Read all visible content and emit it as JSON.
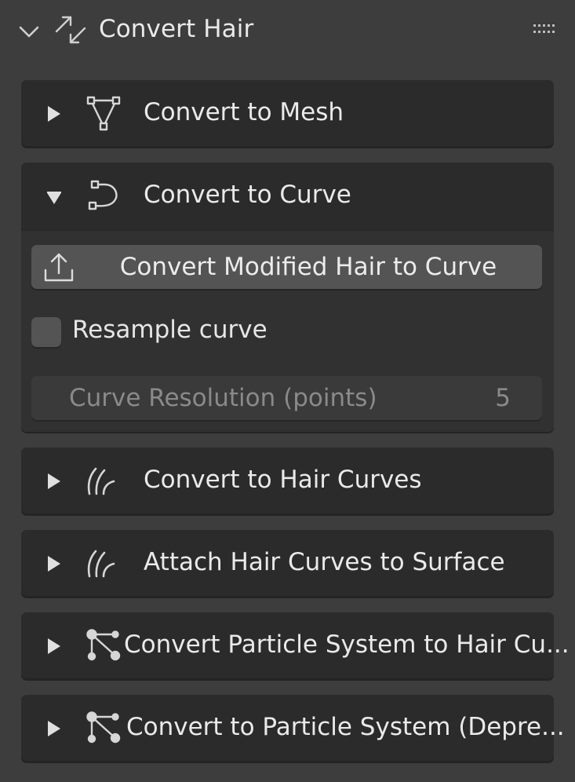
{
  "header": {
    "title": "Convert Hair",
    "expanded": true,
    "icon": "convert-arrows-icon"
  },
  "panels": [
    {
      "label": "Convert to Mesh",
      "icon": "mesh-icon",
      "expanded": false
    },
    {
      "label": "Convert to Curve",
      "icon": "curve-icon",
      "expanded": true
    },
    {
      "label": "Convert to Hair Curves",
      "icon": "hair-curves-icon",
      "expanded": false
    },
    {
      "label": "Attach Hair Curves to Surface",
      "icon": "hair-curves-icon",
      "expanded": false
    },
    {
      "label": "Convert Particle System to Hair Cu...",
      "icon": "particle-system-icon",
      "expanded": false
    },
    {
      "label": "Convert to Particle System (Depre...",
      "icon": "particle-system-icon",
      "expanded": false
    }
  ],
  "curve_panel": {
    "operator_label": "Convert Modified Hair to Curve",
    "operator_icon": "upload-icon",
    "resample_label": "Resample curve",
    "resample_checked": false,
    "resolution_label": "Curve Resolution (points)",
    "resolution_value": "5"
  },
  "colors": {
    "background": "#3d3d3d",
    "panel": "#2b2b2b",
    "button": "#545454",
    "text": "#e6e6e6",
    "disabled_text": "#8a8a8a"
  }
}
